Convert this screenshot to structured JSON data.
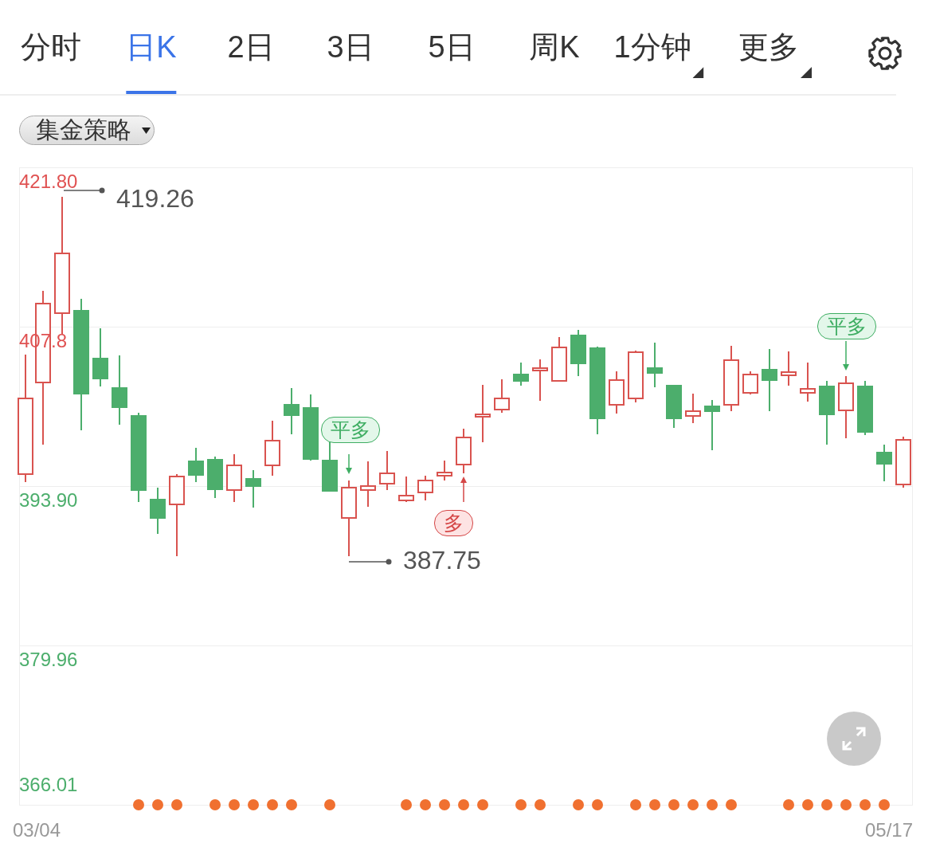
{
  "tabs": [
    {
      "label": "分时",
      "selected": false,
      "has_menu": false
    },
    {
      "label": "日K",
      "selected": true,
      "has_menu": false
    },
    {
      "label": "2日",
      "selected": false,
      "has_menu": false
    },
    {
      "label": "3日",
      "selected": false,
      "has_menu": false
    },
    {
      "label": "5日",
      "selected": false,
      "has_menu": false
    },
    {
      "label": "周K",
      "selected": false,
      "has_menu": false
    },
    {
      "label": "1分钟",
      "selected": false,
      "has_menu": true
    },
    {
      "label": "更多",
      "selected": false,
      "has_menu": true
    }
  ],
  "strategy": {
    "label": "集金策略"
  },
  "chart": {
    "y_labels": [
      {
        "text": "421.80",
        "color": "#e05252"
      },
      {
        "text": "407.8",
        "color": "#e05252"
      },
      {
        "text": "393.90",
        "color": "#4cae6c"
      },
      {
        "text": "379.96",
        "color": "#4cae6c"
      },
      {
        "text": "366.01",
        "color": "#4cae6c"
      }
    ],
    "annotations": [
      {
        "kind": "price",
        "text": "419.26"
      },
      {
        "kind": "price",
        "text": "387.75"
      },
      {
        "kind": "close",
        "text": "平多"
      },
      {
        "kind": "open",
        "text": "多"
      },
      {
        "kind": "close",
        "text": "平多"
      }
    ],
    "x_labels": [
      "03/04",
      "05/17"
    ]
  }
}
